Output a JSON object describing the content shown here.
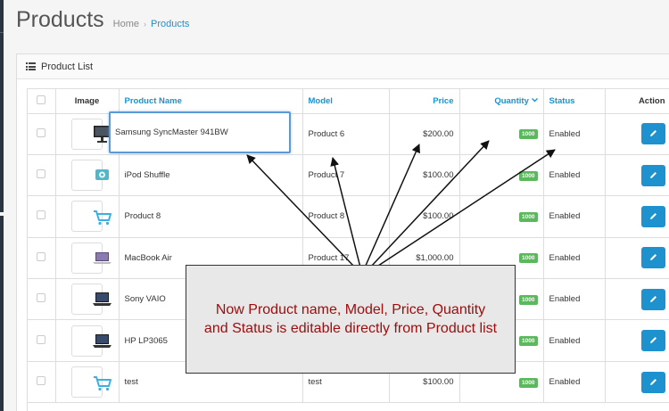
{
  "header": {
    "title": "Products",
    "breadcrumb": [
      "Home",
      "Products"
    ]
  },
  "panel": {
    "title": "Product List"
  },
  "table": {
    "columns": [
      "Image",
      "Product Name",
      "Model",
      "Price",
      "Quantity",
      "Status",
      "Action"
    ],
    "rows": [
      {
        "image": "monitor",
        "name": "Samsung SyncMaster 941BW",
        "model": "Product 6",
        "price": "$200.00",
        "quantity": "1000",
        "status": "Enabled"
      },
      {
        "image": "ipod-shuffle",
        "name": "iPod Shuffle",
        "model": "Product 7",
        "price": "$100.00",
        "quantity": "1000",
        "status": "Enabled"
      },
      {
        "image": "cart-placeholder",
        "name": "Product 8",
        "model": "Product 8",
        "price": "$100.00",
        "quantity": "1000",
        "status": "Enabled"
      },
      {
        "image": "macbook-air",
        "name": "MacBook Air",
        "model": "Product 17",
        "price": "$1,000.00",
        "quantity": "1000",
        "status": "Enabled"
      },
      {
        "image": "laptop",
        "name": "Sony VAIO",
        "model": "",
        "price": "",
        "quantity": "1000",
        "status": "Enabled"
      },
      {
        "image": "laptop",
        "name": "HP LP3065",
        "model": "",
        "price": "",
        "quantity": "1000",
        "status": "Enabled"
      },
      {
        "image": "cart-placeholder",
        "name": "test",
        "model": "test",
        "price": "$100.00",
        "quantity": "1000",
        "status": "Enabled"
      }
    ]
  },
  "callout": {
    "lines": [
      "Now Product name, Model, Price, Quantity",
      "and Status is editable directly from Product list"
    ]
  },
  "colors": {
    "link": "#1e91cf",
    "badge": "#5cb85c",
    "button": "#1e91cf",
    "callout_text": "#a00d0d",
    "focus_border": "#5b9ad8"
  }
}
